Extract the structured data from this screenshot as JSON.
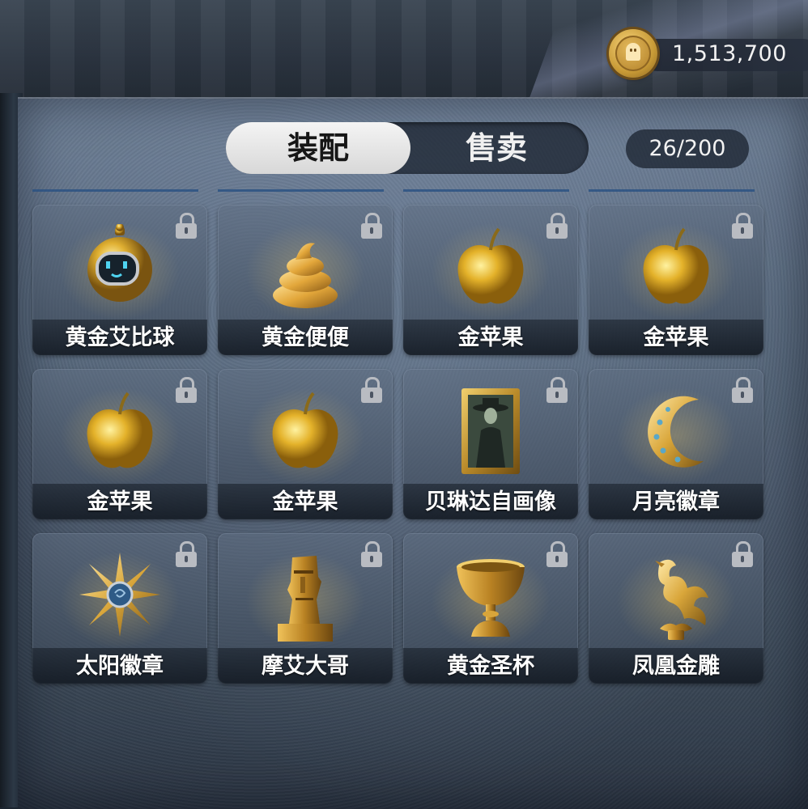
{
  "currency": {
    "icon": "ghost-coin-icon",
    "amount": "1,513,700"
  },
  "tabs": {
    "equip_label": "装配",
    "sell_label": "售卖",
    "active": "equip"
  },
  "capacity": "26/200",
  "items": [
    {
      "name": "黄金艾比球",
      "icon": "golden-robot-ball-icon",
      "locked": true
    },
    {
      "name": "黄金便便",
      "icon": "golden-poop-icon",
      "locked": true
    },
    {
      "name": "金苹果",
      "icon": "golden-apple-icon",
      "locked": true
    },
    {
      "name": "金苹果",
      "icon": "golden-apple-icon",
      "locked": true
    },
    {
      "name": "金苹果",
      "icon": "golden-apple-icon",
      "locked": true
    },
    {
      "name": "金苹果",
      "icon": "golden-apple-icon",
      "locked": true
    },
    {
      "name": "贝琳达自画像",
      "icon": "portrait-painting-icon",
      "locked": true
    },
    {
      "name": "月亮徽章",
      "icon": "moon-badge-icon",
      "locked": true
    },
    {
      "name": "太阳徽章",
      "icon": "sun-badge-icon",
      "locked": true
    },
    {
      "name": "摩艾大哥",
      "icon": "moai-statue-icon",
      "locked": true
    },
    {
      "name": "黄金圣杯",
      "icon": "golden-grail-icon",
      "locked": true
    },
    {
      "name": "凤凰金雕",
      "icon": "phoenix-sculpture-icon",
      "locked": true
    }
  ],
  "colors": {
    "gold": "#d8a93a",
    "tab_active_bg": "#e8e8e8",
    "panel_bg": "#56667a"
  }
}
